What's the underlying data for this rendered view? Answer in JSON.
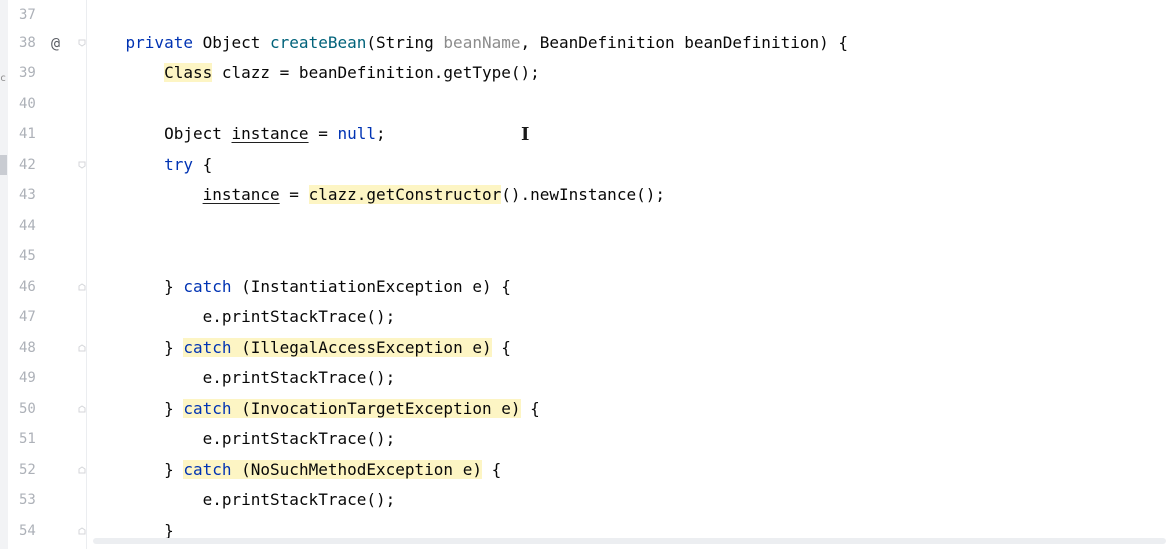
{
  "sidebar_fragment": "c",
  "gutter": {
    "line_numbers": [
      "37",
      "38",
      "39",
      "40",
      "41",
      "42",
      "43",
      "44",
      "45",
      "46",
      "47",
      "48",
      "49",
      "50",
      "51",
      "52",
      "53",
      "54"
    ],
    "annotation_marker": "@"
  },
  "code": {
    "l37": "",
    "l38": {
      "indent": "    ",
      "private": "private",
      "sp1": " Object ",
      "method": "createBean",
      "open": "(String ",
      "unused_param": "beanName",
      "rest": ", BeanDefinition beanDefinition) {"
    },
    "l39": {
      "indent": "        ",
      "class_kw": "Class",
      "rest": " clazz = beanDefinition.getType();"
    },
    "l40": "",
    "l41": {
      "indent": "        ",
      "type": "Object ",
      "var": "instance",
      "eq": " = ",
      "null": "null",
      "semi": ";"
    },
    "l42": {
      "indent": "        ",
      "try": "try",
      "rest": " {"
    },
    "l43": {
      "indent": "            ",
      "var": "instance",
      "eq": " = ",
      "call": "clazz.getConstructor",
      "rest": "().newInstance();"
    },
    "l44": "",
    "l45": "",
    "l46": {
      "indent": "        ",
      "close": "} ",
      "catch": "catch",
      "rest": " (InstantiationException e) {"
    },
    "l47": {
      "indent": "            ",
      "text": "e.printStackTrace();"
    },
    "l48": {
      "indent": "        ",
      "close": "} ",
      "catch": "catch",
      "sp": " ",
      "exc": "(IllegalAccessException e)",
      "rest": " {"
    },
    "l49": {
      "indent": "            ",
      "text": "e.printStackTrace();"
    },
    "l50": {
      "indent": "        ",
      "close": "} ",
      "catch": "catch",
      "sp": " ",
      "exc": "(InvocationTargetException e)",
      "rest": " {"
    },
    "l51": {
      "indent": "            ",
      "text": "e.printStackTrace();"
    },
    "l52": {
      "indent": "        ",
      "close": "} ",
      "catch": "catch",
      "sp": " ",
      "exc": "(NoSuchMethodException e)",
      "rest": " {"
    },
    "l53": {
      "indent": "            ",
      "text": "e.printStackTrace();"
    },
    "l54": {
      "indent": "        ",
      "text": "}"
    }
  },
  "cursor_glyph": "I",
  "colors": {
    "keyword": "#0033b3",
    "method": "#00627a",
    "unused": "#8c8c8c",
    "highlight": "#fdf5c4",
    "line_number": "#adb1b8"
  }
}
